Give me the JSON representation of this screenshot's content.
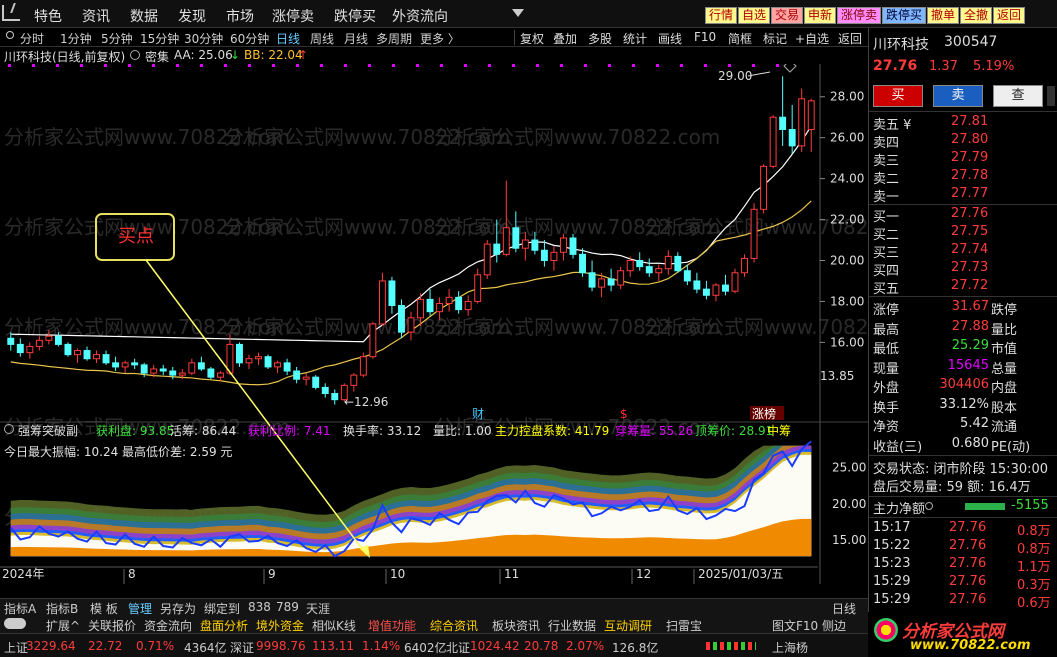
{
  "menu": {
    "items": [
      "特色",
      "资讯",
      "数据",
      "发现",
      "市场",
      "涨停卖",
      "跌停买",
      "外资流向"
    ],
    "right_buttons": [
      "行情",
      "自选",
      "交易",
      "申新",
      "涨停卖",
      "跌停买",
      "撤单",
      "全撤",
      "返回"
    ]
  },
  "period_bar": {
    "items": [
      "分时",
      "1分钟",
      "5分钟",
      "15分钟",
      "30分钟",
      "60分钟",
      "日线",
      "周线",
      "月线",
      "多周期",
      "更多 〉"
    ],
    "selected": "日线",
    "right_items": [
      "复权",
      "叠加",
      "多股",
      "统计",
      "画线",
      "F10",
      "简框",
      "标记",
      "+自选",
      "返回"
    ]
  },
  "info_line": {
    "stock": "川环科技(日线,前复权)",
    "indicator": "密集",
    "aa": "AA: 25.06",
    "aa_arrow": "↓",
    "bb": "BB: 22.04",
    "bb_arrow": "↑"
  },
  "indicator_line": {
    "name": "强筹突破副",
    "items": [
      {
        "text": "获利盘: 93.85",
        "color": "#3cdc3c"
      },
      {
        "text": "活筹: 86.44",
        "color": "#e0e0e0"
      },
      {
        "text": "获利比例: 7.41",
        "color": "#e000ff"
      },
      {
        "text": "换手率: 33.12",
        "color": "#e0e0e0"
      },
      {
        "text": "量比: 1.00",
        "color": "#e0e0e0"
      },
      {
        "text": "主力控盘系数: 41.79",
        "color": "#ffff00"
      },
      {
        "text": "穿筹量: 55.26",
        "color": "#e000ff"
      },
      {
        "text": "顶筹价: 28.91",
        "color": "#3cdc3c"
      },
      {
        "text": "中筹",
        "color": "#ffff00"
      }
    ],
    "amp_text": "今日最大振幅: 10.24 最高低价差: 2.59 元"
  },
  "annotations": {
    "buy_label": "买点",
    "high_label": "29.00",
    "low_label": "12.96",
    "cai_mark": "财",
    "s_mark": "$",
    "zhangbang_mark": "涨榜"
  },
  "watermark": "分析家公式网www.70822.com",
  "chart_data": {
    "type": "candlestick",
    "price_axis_ticks": [
      28.0,
      26.0,
      24.0,
      22.0,
      20.0,
      18.0,
      16.0
    ],
    "price_axis_extra": "13.85",
    "ylim": [
      12.5,
      29.6
    ],
    "indicator_axis_ticks": [
      25.0,
      20.0,
      15.0
    ],
    "indicator_ylim": [
      12.0,
      28.5
    ],
    "x_labels": [
      "2024年",
      "8",
      "9",
      "10",
      "11",
      "12",
      "2025/01/03/五"
    ],
    "candles": [
      [
        16.2,
        16.5,
        15.6,
        15.9
      ],
      [
        15.9,
        16.2,
        15.3,
        15.5
      ],
      [
        15.5,
        16.0,
        15.2,
        15.8
      ],
      [
        15.8,
        16.3,
        15.6,
        16.1
      ],
      [
        16.1,
        16.6,
        15.9,
        16.3
      ],
      [
        16.3,
        16.5,
        15.8,
        15.9
      ],
      [
        15.9,
        16.0,
        15.3,
        15.4
      ],
      [
        15.4,
        15.7,
        15.0,
        15.6
      ],
      [
        15.6,
        15.8,
        15.1,
        15.2
      ],
      [
        15.2,
        15.6,
        15.0,
        15.4
      ],
      [
        15.4,
        15.6,
        14.9,
        15.0
      ],
      [
        15.0,
        15.3,
        14.6,
        14.8
      ],
      [
        14.8,
        15.1,
        14.5,
        15.0
      ],
      [
        15.0,
        15.2,
        14.7,
        14.9
      ],
      [
        14.9,
        15.0,
        14.3,
        14.5
      ],
      [
        14.5,
        14.9,
        14.3,
        14.7
      ],
      [
        14.7,
        14.9,
        14.4,
        14.6
      ],
      [
        14.6,
        14.8,
        14.2,
        14.4
      ],
      [
        14.4,
        14.7,
        14.2,
        14.5
      ],
      [
        14.5,
        15.2,
        14.4,
        15.0
      ],
      [
        15.0,
        15.3,
        14.6,
        14.7
      ],
      [
        14.7,
        14.8,
        14.2,
        14.3
      ],
      [
        14.3,
        14.6,
        14.1,
        14.5
      ],
      [
        14.5,
        16.4,
        14.4,
        15.9
      ],
      [
        15.9,
        16.0,
        14.8,
        15.0
      ],
      [
        15.0,
        15.4,
        14.7,
        15.2
      ],
      [
        15.2,
        15.5,
        14.9,
        15.3
      ],
      [
        15.3,
        15.4,
        14.7,
        14.8
      ],
      [
        14.8,
        15.1,
        14.5,
        15.0
      ],
      [
        15.0,
        15.2,
        14.4,
        14.6
      ],
      [
        14.6,
        14.8,
        14.0,
        14.2
      ],
      [
        14.2,
        14.5,
        13.9,
        14.3
      ],
      [
        14.3,
        14.4,
        13.7,
        13.8
      ],
      [
        13.8,
        14.0,
        13.3,
        13.5
      ],
      [
        13.5,
        13.7,
        12.96,
        13.2
      ],
      [
        13.2,
        14.0,
        13.1,
        13.9
      ],
      [
        13.9,
        14.5,
        13.6,
        14.4
      ],
      [
        14.4,
        15.5,
        14.3,
        15.3
      ],
      [
        15.3,
        17.0,
        15.2,
        16.9
      ],
      [
        16.9,
        19.4,
        16.8,
        19.0
      ],
      [
        19.0,
        19.2,
        17.4,
        17.8
      ],
      [
        17.8,
        18.1,
        16.2,
        16.5
      ],
      [
        16.5,
        17.5,
        16.1,
        17.2
      ],
      [
        17.2,
        18.4,
        16.8,
        18.1
      ],
      [
        18.1,
        18.6,
        17.3,
        17.5
      ],
      [
        17.5,
        18.2,
        17.1,
        17.9
      ],
      [
        17.9,
        18.6,
        17.5,
        18.2
      ],
      [
        18.2,
        18.5,
        17.4,
        17.6
      ],
      [
        17.6,
        18.3,
        17.3,
        18.0
      ],
      [
        18.0,
        19.6,
        17.9,
        19.3
      ],
      [
        19.3,
        21.0,
        19.1,
        20.8
      ],
      [
        20.8,
        22.0,
        19.9,
        20.3
      ],
      [
        20.3,
        23.9,
        20.2,
        21.6
      ],
      [
        21.6,
        22.4,
        20.4,
        20.6
      ],
      [
        20.6,
        21.4,
        20.0,
        21.0
      ],
      [
        21.0,
        21.4,
        20.3,
        20.5
      ],
      [
        20.5,
        21.0,
        19.7,
        20.0
      ],
      [
        20.0,
        20.7,
        19.5,
        20.4
      ],
      [
        20.4,
        21.3,
        20.0,
        21.1
      ],
      [
        21.1,
        21.3,
        20.1,
        20.3
      ],
      [
        20.3,
        20.6,
        19.2,
        19.4
      ],
      [
        19.4,
        20.0,
        18.5,
        18.7
      ],
      [
        18.7,
        19.4,
        18.2,
        19.1
      ],
      [
        19.1,
        19.6,
        18.5,
        18.8
      ],
      [
        18.8,
        19.7,
        18.6,
        19.5
      ],
      [
        19.5,
        20.2,
        19.2,
        20.0
      ],
      [
        20.0,
        20.4,
        19.5,
        19.7
      ],
      [
        19.7,
        20.1,
        19.2,
        19.4
      ],
      [
        19.4,
        19.8,
        19.0,
        19.6
      ],
      [
        19.6,
        20.5,
        19.3,
        20.2
      ],
      [
        20.2,
        20.4,
        19.4,
        19.5
      ],
      [
        19.5,
        19.8,
        18.8,
        19.0
      ],
      [
        19.0,
        19.4,
        18.4,
        18.6
      ],
      [
        18.6,
        19.0,
        18.1,
        18.3
      ],
      [
        18.3,
        18.9,
        18.0,
        18.8
      ],
      [
        18.8,
        19.3,
        18.3,
        18.5
      ],
      [
        18.5,
        19.6,
        18.4,
        19.4
      ],
      [
        19.4,
        20.3,
        19.2,
        20.1
      ],
      [
        20.1,
        22.8,
        19.9,
        22.5
      ],
      [
        22.5,
        24.7,
        22.3,
        24.6
      ],
      [
        24.6,
        27.1,
        24.5,
        27.0
      ],
      [
        27.0,
        29.0,
        25.6,
        26.4
      ],
      [
        26.4,
        27.6,
        25.2,
        25.6
      ],
      [
        25.6,
        28.4,
        25.3,
        27.9
      ],
      [
        26.4,
        27.9,
        25.3,
        27.8
      ]
    ]
  },
  "right_panel": {
    "name": "川环科技",
    "code": "300547",
    "price": "27.76",
    "change": "1.37",
    "pct": "5.19%",
    "buttons": [
      "买",
      "卖",
      "查"
    ],
    "asks": [
      {
        "label": "卖五 ¥",
        "price": "27.81"
      },
      {
        "label": "卖四",
        "price": "27.80"
      },
      {
        "label": "卖三",
        "price": "27.79"
      },
      {
        "label": "卖二",
        "price": "27.78"
      },
      {
        "label": "卖一",
        "price": "27.77"
      }
    ],
    "bids": [
      {
        "label": "买一",
        "price": "27.76"
      },
      {
        "label": "买二",
        "price": "27.75"
      },
      {
        "label": "买三",
        "price": "27.74"
      },
      {
        "label": "买四",
        "price": "27.73"
      },
      {
        "label": "买五",
        "price": "27.72"
      }
    ],
    "stats": [
      {
        "l": "涨停",
        "v": "31.67",
        "vc": "#ff3c3c",
        "r": "跌停"
      },
      {
        "l": "最高",
        "v": "27.88",
        "vc": "#ff3c3c",
        "r": "量比"
      },
      {
        "l": "最低",
        "v": "25.29",
        "vc": "#3cdc3c",
        "r": "市值"
      },
      {
        "l": "现量",
        "v": "15645",
        "vc": "#e000ff",
        "r": "总量"
      },
      {
        "l": "外盘",
        "v": "304406",
        "vc": "#ff3c3c",
        "r": "内盘"
      },
      {
        "l": "换手",
        "v": "33.12%",
        "vc": "#e0e0e0",
        "r": "股本"
      },
      {
        "l": "净资",
        "v": "5.42",
        "vc": "#e0e0e0",
        "r": "流通"
      },
      {
        "l": "收益(三)",
        "v": "0.680",
        "vc": "#e0e0e0",
        "r": "PE(动)"
      }
    ],
    "trade_state": "交易状态: 闭市阶段 15:30:00",
    "post_vol": "盘后交易量: 59  额: 16.4万",
    "main_net": {
      "label": "主力净额",
      "value": "-5155"
    },
    "ticks": [
      {
        "time": "15:17",
        "price": "27.76",
        "amt": "0.8万"
      },
      {
        "time": "15:22",
        "price": "27.76",
        "amt": "0.8万"
      },
      {
        "time": "15:23",
        "price": "27.76",
        "amt": "1.1万"
      },
      {
        "time": "15:29",
        "price": "27.76",
        "amt": "0.3万"
      },
      {
        "time": "15:29",
        "price": "27.76",
        "amt": "0.6万"
      }
    ]
  },
  "bottom": {
    "tabs1": [
      "指标A",
      "指标B",
      "模 板",
      "管理",
      "另存为",
      "绑定到",
      "838",
      "789",
      "天涯"
    ],
    "tabs1_right": "日线",
    "tabs2": [
      {
        "t": "扩展^",
        "c": "#ccc"
      },
      {
        "t": "关联报价",
        "c": "#ccc"
      },
      {
        "t": "资金流向",
        "c": "#ccc"
      },
      {
        "t": "盘面分析",
        "c": "#ffd200"
      },
      {
        "t": "境外资金",
        "c": "#ffd200"
      },
      {
        "t": "相似K线",
        "c": "#ccc"
      },
      {
        "t": "增值功能",
        "c": "#ff5050"
      },
      {
        "t": "综合资讯",
        "c": "#ffd200"
      },
      {
        "t": "板块资讯",
        "c": "#ccc"
      },
      {
        "t": "行业数据",
        "c": "#ccc"
      },
      {
        "t": "互动调研",
        "c": "#ffd200"
      },
      {
        "t": "扫雷宝",
        "c": "#ccc"
      }
    ],
    "tabs2_right": [
      "图文F10",
      "侧边"
    ],
    "tabs3": [
      {
        "t": "上证",
        "c": "#ccc"
      },
      {
        "t": "3229.64",
        "c": "#ff3c3c"
      },
      {
        "t": "22.72",
        "c": "#ff3c3c"
      },
      {
        "t": "0.71%",
        "c": "#ff3c3c"
      },
      {
        "t": "4364亿",
        "c": "#ccc"
      },
      {
        "t": "深证",
        "c": "#ccc"
      },
      {
        "t": "9998.76",
        "c": "#ff3c3c"
      },
      {
        "t": "113.11",
        "c": "#ff3c3c"
      },
      {
        "t": "1.14%",
        "c": "#ff3c3c"
      },
      {
        "t": "6402亿",
        "c": "#ccc"
      },
      {
        "t": "北证",
        "c": "#ccc"
      },
      {
        "t": "1024.42",
        "c": "#ff3c3c"
      },
      {
        "t": "20.78",
        "c": "#ff3c3c"
      },
      {
        "t": "2.07%",
        "c": "#ff3c3c"
      },
      {
        "t": "126.8亿",
        "c": "#ccc"
      },
      {
        "t": "上海杨",
        "c": "#ccc"
      }
    ]
  },
  "brand": {
    "name": "分析家公式网",
    "url": "www.70822.com"
  },
  "colors": {
    "up": "#ff3c3c",
    "down": "#54ffff",
    "line_white": "#ffffff",
    "line_yellow": "#e8c44a",
    "arrow": "#ffff66"
  }
}
